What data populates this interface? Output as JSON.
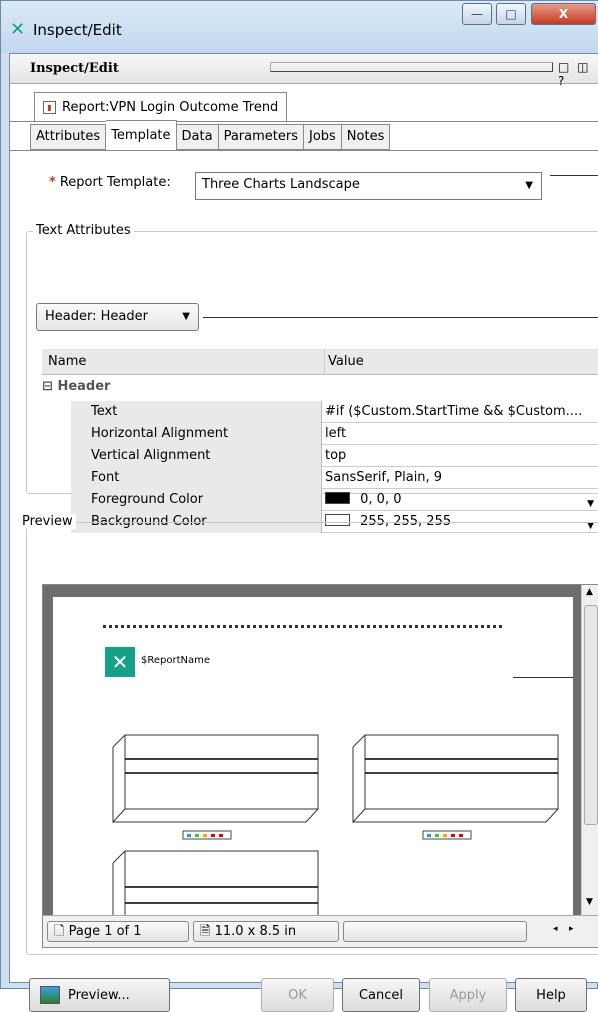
{
  "window": {
    "title": "Inspect/Edit",
    "min_label": "—",
    "max_label": "□",
    "close_label": "X"
  },
  "panel": {
    "title": "Inspect/Edit",
    "icons": "□ ◫ ?"
  },
  "report_tab": {
    "label": "Report:VPN Login Outcome Trend"
  },
  "tabs": [
    "Attributes",
    "Template",
    "Data",
    "Parameters",
    "Jobs",
    "Notes"
  ],
  "active_tab": "Template",
  "template": {
    "label": "Report Template:",
    "required_mark": "*",
    "value": "Three Charts Landscape"
  },
  "text_attributes": {
    "legend": "Text Attributes",
    "selected": "Header: Header",
    "table": {
      "col_name": "Name",
      "col_value": "Value",
      "group_toggle": "⊟",
      "group": "Header",
      "rows": [
        {
          "name": "Text",
          "value": "#if ($Custom.StartTime && $Custom...."
        },
        {
          "name": "Horizontal Alignment",
          "value": "left"
        },
        {
          "name": "Vertical Alignment",
          "value": "top"
        },
        {
          "name": "Font",
          "value": "SansSerif, Plain, 9"
        },
        {
          "name": "Foreground Color",
          "value": "0, 0, 0",
          "swatch": "#000000"
        },
        {
          "name": "Background Color",
          "value": "255, 255, 255",
          "swatch": "#ffffff"
        }
      ]
    }
  },
  "preview": {
    "legend": "Preview",
    "report_name": "$ReportName",
    "page_label": "Page 1 of 1",
    "size_label": "11.0 x 8.5 in"
  },
  "buttons": {
    "preview": "Preview...",
    "ok": "OK",
    "cancel": "Cancel",
    "apply": "Apply",
    "help": "Help"
  },
  "colors": {
    "brand": "#16a085",
    "required": "#c0392b"
  }
}
